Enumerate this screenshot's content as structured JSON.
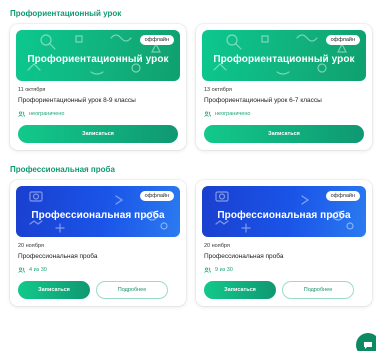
{
  "sections": [
    {
      "title": "Профориентационный урок",
      "cards": [
        {
          "badge": "оффлайн",
          "banner_title": "Профориентационный урок",
          "date": "11 октября",
          "name": "Профориентационный урок 8-9 классы",
          "seats": "неограничено",
          "primary_label": "Записаться"
        },
        {
          "badge": "оффлайн",
          "banner_title": "Профориентационный урок",
          "date": "13 октября",
          "name": "Профориентационный урок 6-7 классы",
          "seats": "неограничено",
          "primary_label": "Записаться"
        }
      ]
    },
    {
      "title": "Профессиональная проба",
      "cards": [
        {
          "badge": "оффлайн",
          "banner_title": "Профессиональная проба",
          "date": "20 ноября",
          "name": "Профессиональная проба",
          "seats": "4 из 30",
          "primary_label": "Записаться",
          "secondary_label": "Подробнее"
        },
        {
          "badge": "оффлайн",
          "banner_title": "Профессиональная проба",
          "date": "20 ноября",
          "name": "Профессиональная проба",
          "seats": "9 из 30",
          "primary_label": "Записаться",
          "secondary_label": "Подробнее"
        }
      ]
    }
  ],
  "icons": {
    "seats": "people-icon",
    "chat": "chat-icon"
  },
  "colors": {
    "accent_green": "#109a72",
    "banner_green": "#0cc88f",
    "banner_blue": "#1a3fcf",
    "button_green": "#12c98a"
  }
}
